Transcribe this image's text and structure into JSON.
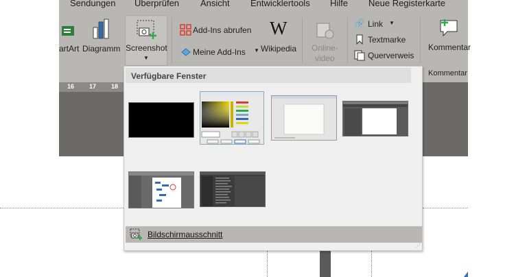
{
  "ribbon": {
    "tabs": [
      "Sendungen",
      "Überprüfen",
      "Ansicht",
      "Entwicklertools",
      "Hilfe",
      "Neue Registerkarte"
    ],
    "buttons": {
      "smartart": "artArt",
      "diagramm": "Diagramm",
      "screenshot": "Screenshot",
      "addins_abrufen": "Add-Ins abrufen",
      "meine_addins": "Meine Add-Ins",
      "wikipedia": "Wikipedia",
      "online_video": "Online-\nvideo",
      "link": "Link",
      "textmarke": "Textmarke",
      "querverweis": "Querverweis",
      "kommentar": "Kommentar"
    },
    "group_label_kommentare": "Kommentar"
  },
  "ruler": {
    "numbers": [
      "16",
      "17",
      "18"
    ]
  },
  "dropdown": {
    "header": "Verfügbare Fenster",
    "windows": [
      {
        "name": "black-window"
      },
      {
        "name": "color-dialog"
      },
      {
        "name": "blank-document-window"
      },
      {
        "name": "dark-app-window"
      },
      {
        "name": "diagram-window"
      },
      {
        "name": "file-explorer-window"
      }
    ],
    "footer_label": "Bildschirmausschnitt"
  },
  "colors": {
    "ribbon_bg": "#b9b7b3",
    "doc_dark": "#6b6a69",
    "dropdown_bg": "#efefef",
    "accent_green": "#2ea84c",
    "accent_red": "#d93b2b",
    "accent_blue": "#2e6db4"
  }
}
